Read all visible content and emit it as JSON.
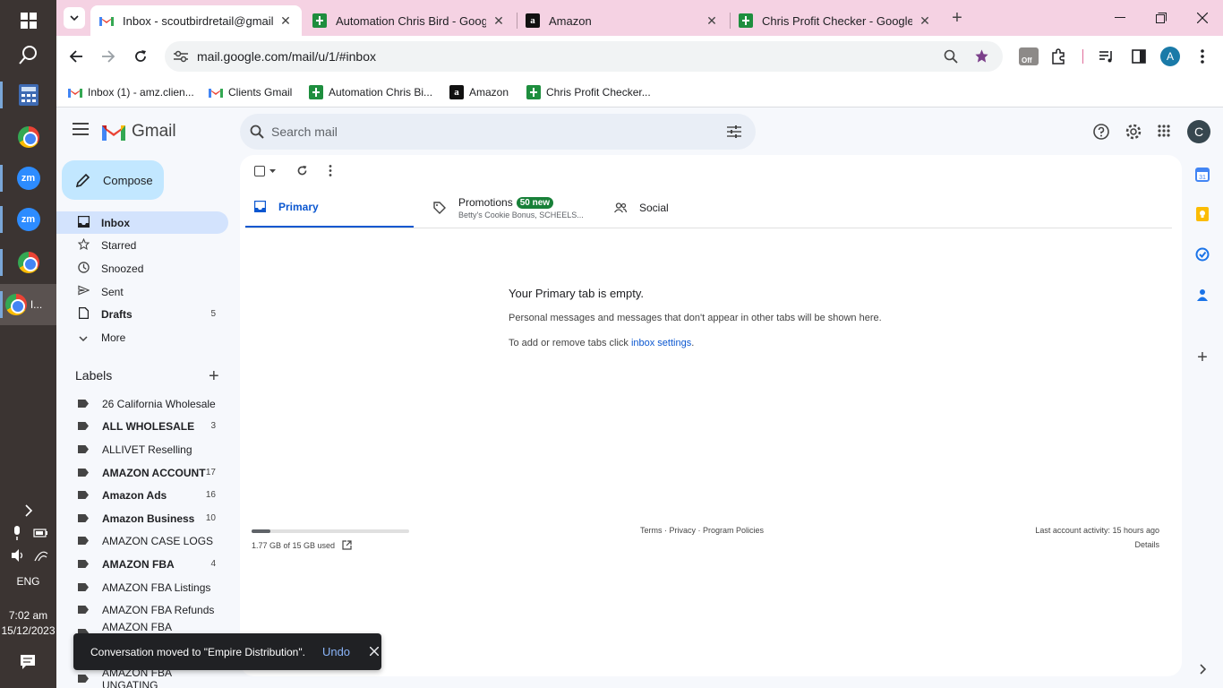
{
  "taskbar": {
    "language": "ENG",
    "time": "7:02 am",
    "date": "15/12/2023",
    "zoom_label": "zm",
    "active_app_label": "I..."
  },
  "browser": {
    "tabs": [
      {
        "title": "Inbox - scoutbirdretail@gmail.c",
        "favicon": "gmail-icon"
      },
      {
        "title": "Automation Chris Bird - Google",
        "favicon": "sheets-icon"
      },
      {
        "title": "Amazon",
        "favicon": "amazon-icon"
      },
      {
        "title": "Chris Profit Checker - Google S",
        "favicon": "sheets-icon"
      }
    ],
    "url": "mail.google.com/mail/u/1/#inbox",
    "profile_initial": "A",
    "extension_badge": "Off",
    "bookmarks": [
      {
        "label": "Inbox (1) - amz.clien...",
        "favicon": "gmail-icon"
      },
      {
        "label": "Clients Gmail",
        "favicon": "gmail-icon"
      },
      {
        "label": "Automation Chris Bi...",
        "favicon": "sheets-icon"
      },
      {
        "label": "Amazon",
        "favicon": "amazon-icon"
      },
      {
        "label": "Chris Profit Checker...",
        "favicon": "sheets-icon"
      }
    ]
  },
  "gmail": {
    "logo_text": "Gmail",
    "search_placeholder": "Search mail",
    "account_initial": "C",
    "compose_label": "Compose",
    "nav": [
      {
        "label": "Inbox",
        "count": "",
        "icon": "inbox-icon",
        "selected": true
      },
      {
        "label": "Starred",
        "count": "",
        "icon": "star-icon"
      },
      {
        "label": "Snoozed",
        "count": "",
        "icon": "clock-icon"
      },
      {
        "label": "Sent",
        "count": "",
        "icon": "send-icon"
      },
      {
        "label": "Drafts",
        "count": "5",
        "icon": "draft-icon"
      },
      {
        "label": "More",
        "count": "",
        "icon": "chevron-down-icon"
      }
    ],
    "labels_heading": "Labels",
    "labels": [
      {
        "label": "26 California Wholesale",
        "count": "",
        "bold": false
      },
      {
        "label": "ALL WHOLESALE",
        "count": "3",
        "bold": true
      },
      {
        "label": "ALLIVET Reselling",
        "count": "",
        "bold": false
      },
      {
        "label": "AMAZON ACCOUNT",
        "count": "17",
        "bold": true
      },
      {
        "label": "Amazon Ads",
        "count": "16",
        "bold": true
      },
      {
        "label": "Amazon Business",
        "count": "10",
        "bold": true
      },
      {
        "label": "AMAZON CASE LOGS",
        "count": "",
        "bold": false
      },
      {
        "label": "AMAZON FBA",
        "count": "4",
        "bold": true
      },
      {
        "label": "AMAZON FBA Listings",
        "count": "",
        "bold": false
      },
      {
        "label": "AMAZON FBA Refunds",
        "count": "",
        "bold": false
      },
      {
        "label": "AMAZON FBA Removals",
        "count": "",
        "bold": false
      },
      {
        "label": "AMAZON FBA UNGATING",
        "count": "",
        "bold": false
      }
    ],
    "tabs": [
      {
        "label": "Primary",
        "subtitle": "",
        "badge": "",
        "icon": "inbox-icon"
      },
      {
        "label": "Promotions",
        "subtitle": "Betty's Cookie Bonus, SCHEELS...",
        "badge": "50 new",
        "icon": "tag-icon"
      },
      {
        "label": "Social",
        "subtitle": "",
        "badge": "",
        "icon": "people-icon"
      }
    ],
    "empty_title": "Your Primary tab is empty.",
    "empty_line1": "Personal messages and messages that don't appear in other tabs will be shown here.",
    "empty_line2_prefix": "To add or remove tabs click ",
    "empty_line2_link": "inbox settings",
    "empty_line2_suffix": ".",
    "storage_text": "1.77 GB of 15 GB used",
    "storage_fraction": 0.118,
    "footer_links": "Terms · Privacy · Program Policies",
    "last_activity": "Last account activity: 15 hours ago",
    "details_link": "Details"
  },
  "toast": {
    "message": "Conversation moved to \"Empire Distribution\".",
    "undo_label": "Undo"
  },
  "colors": {
    "accent": "#0b57d0",
    "compose_bg": "#c2e7ff",
    "selected_bg": "#d3e3fd",
    "tabstrip_bg": "#f5d2e3",
    "badge_green": "#188038"
  }
}
